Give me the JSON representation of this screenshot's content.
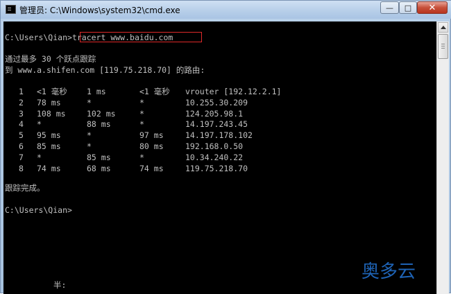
{
  "window": {
    "title": "管理员: C:\\Windows\\system32\\cmd.exe",
    "controls": {
      "minimize": "—",
      "maximize": "□",
      "close": "✕"
    }
  },
  "console": {
    "prompt1": "C:\\Users\\Qian>",
    "command": "tracert www.baidu.com",
    "header1": "通过最多 30 个跃点跟踪",
    "header2": "到 www.a.shifen.com [119.75.218.70] 的路由:",
    "hops": [
      {
        "n": "1",
        "r1": "<1 毫秒",
        "r2": "1 ms",
        "r3": "<1 毫秒",
        "host": "vrouter [192.12.2.1]"
      },
      {
        "n": "2",
        "r1": "78 ms",
        "r2": "*",
        "r3": "*",
        "host": "10.255.30.209"
      },
      {
        "n": "3",
        "r1": "108 ms",
        "r2": "102 ms",
        "r3": "*",
        "host": "124.205.98.1"
      },
      {
        "n": "4",
        "r1": "*",
        "r2": "88 ms",
        "r3": "*",
        "host": "14.197.243.45"
      },
      {
        "n": "5",
        "r1": "95 ms",
        "r2": "*",
        "r3": "97 ms",
        "host": "14.197.178.102"
      },
      {
        "n": "6",
        "r1": "85 ms",
        "r2": "*",
        "r3": "80 ms",
        "host": "192.168.0.50"
      },
      {
        "n": "7",
        "r1": "*",
        "r2": "85 ms",
        "r3": "*",
        "host": "10.34.240.22"
      },
      {
        "n": "8",
        "r1": "74 ms",
        "r2": "68 ms",
        "r3": "74 ms",
        "host": "119.75.218.70"
      }
    ],
    "complete": "跟踪完成。",
    "prompt2": "C:\\Users\\Qian>",
    "ime_status": "半:"
  },
  "watermark": "奥多云",
  "colors": {
    "console_bg": "#000000",
    "console_text": "#c0c0c0",
    "highlight_box": "#e02a2a",
    "watermark": "#1e63b5"
  }
}
